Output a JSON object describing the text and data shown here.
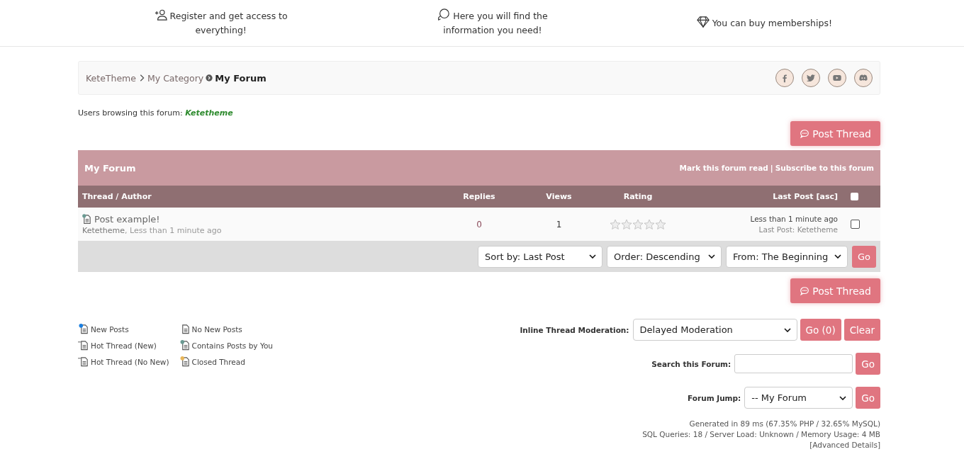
{
  "top_features": [
    {
      "kind": "register",
      "text": "Register and get access to everything!"
    },
    {
      "kind": "chat",
      "text": "Here you will find the information you need!"
    },
    {
      "kind": "diamond",
      "text": "You can buy memberships!"
    }
  ],
  "breadcrumb": {
    "links": [
      "KeteTheme",
      "My Category"
    ],
    "current": "My Forum"
  },
  "social": [
    {
      "kind": "facebook"
    },
    {
      "kind": "twitter"
    },
    {
      "kind": "youtube"
    },
    {
      "kind": "discord"
    }
  ],
  "browsing": {
    "label": "Users browsing this forum:",
    "user": "Ketetheme"
  },
  "post_thread_button": "Post Thread",
  "forum": {
    "title": "My Forum",
    "mark_read": "Mark this forum read",
    "separator": "|",
    "subscribe": "Subscribe to this forum"
  },
  "columns": [
    "Thread / Author",
    "Replies",
    "Views",
    "Rating",
    "Last Post [asc]"
  ],
  "select_all": {
    "checked": false
  },
  "threads": [
    {
      "kind": "own",
      "title": "Post example!",
      "author": "Ketetheme",
      "author_separator": ",",
      "time": "Less than 1 minute ago",
      "replies": "0",
      "views": "1",
      "stars": 0,
      "last_time": "Less than 1 minute ago",
      "last_post_label": "Last Post:",
      "last_post_user": "Ketetheme",
      "checked": false
    }
  ],
  "sort": {
    "sort_by": "Sort by: Last Post",
    "order": "Order: Descending",
    "from": "From: The Beginning",
    "go": "Go"
  },
  "post_thread_button_bottom": "Post Thread",
  "legend": [
    {
      "kind": "new",
      "label": "New Posts"
    },
    {
      "kind": "hot-new",
      "label": "Hot Thread (New)"
    },
    {
      "kind": "hot",
      "label": "Hot Thread (No New)"
    },
    {
      "kind": "plain",
      "label": "No New Posts"
    },
    {
      "kind": "own",
      "label": "Contains Posts by You"
    },
    {
      "kind": "closed",
      "label": "Closed Thread"
    }
  ],
  "moderation": {
    "label": "Inline Thread Moderation:",
    "value": "Delayed Moderation",
    "go": "Go (0)",
    "clear": "Clear"
  },
  "search": {
    "label": "Search this Forum:",
    "go": "Go"
  },
  "jump": {
    "label": "Forum Jump:",
    "value": "-- My Forum",
    "go": "Go"
  },
  "footer": {
    "generated": "Generated in 89 ms (67.35% PHP / 32.65% MySQL)",
    "stats": "SQL Queries: 18 / Server Load: Unknown / Memory Usage: 4 MB",
    "advanced": "[Advanced Details]"
  }
}
